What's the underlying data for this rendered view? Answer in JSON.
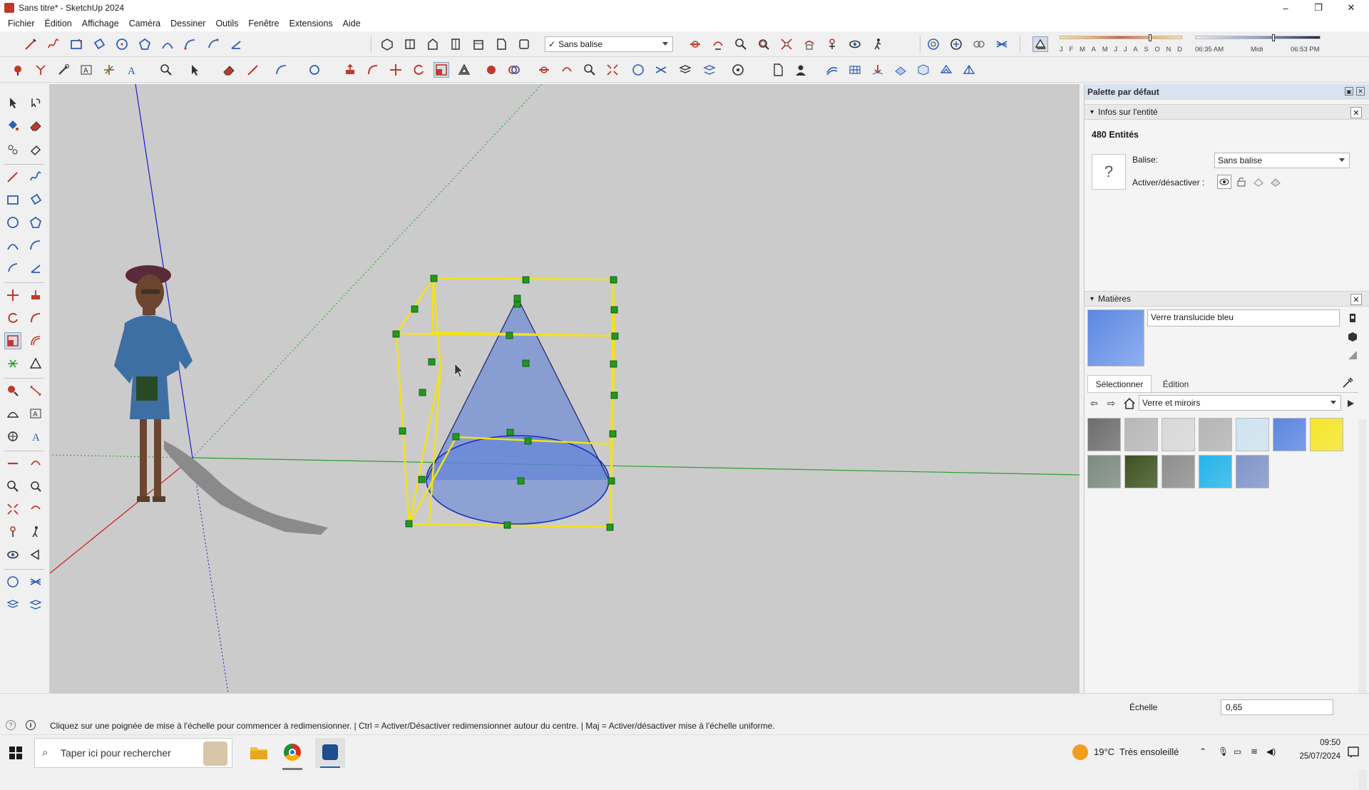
{
  "window": {
    "title": "Sans titre* - SketchUp 2024",
    "minimize": "–",
    "restore": "❐",
    "close": "✕"
  },
  "menu": [
    "Fichier",
    "Édition",
    "Affichage",
    "Caméra",
    "Dessiner",
    "Outils",
    "Fenêtre",
    "Extensions",
    "Aide"
  ],
  "toolbar": {
    "tag_selector": {
      "check": "✓",
      "value": "Sans balise"
    },
    "shadow": {
      "months": [
        "J",
        "F",
        "M",
        "A",
        "M",
        "J",
        "J",
        "A",
        "S",
        "O",
        "N",
        "D"
      ],
      "time_start": "06:35 AM",
      "time_mid": "Midi",
      "time_end": "06:53 PM",
      "month_level": 0.74,
      "time_level": 0.62
    }
  },
  "tray": {
    "title": "Palette par défaut",
    "entity_info": {
      "header": "Infos sur l'entité",
      "count": "480 Entités",
      "icon": "?",
      "tag_label": "Balise:",
      "tag_value": "Sans balise",
      "toggle_label": "Activer/désactiver :"
    },
    "materials": {
      "header": "Matières",
      "name": "Verre translucide bleu",
      "tab_select": "Sélectionner",
      "tab_edit": "Édition",
      "library": "Verre et miroirs",
      "current_color": "#5b86e0",
      "swatches": [
        {
          "name": "swatch-dark-glass-blocks",
          "color": "#6e6e6e"
        },
        {
          "name": "swatch-grey-gradient",
          "color": "#b8b8b8"
        },
        {
          "name": "swatch-light-grey",
          "color": "#d8d8d8"
        },
        {
          "name": "swatch-frosted-glass",
          "color": "#b5b5b5"
        },
        {
          "name": "swatch-light-blue-pattern",
          "color": "#cfe3f0"
        },
        {
          "name": "swatch-blue-glass",
          "color": "#5b86e0"
        },
        {
          "name": "swatch-yellow-glass",
          "color": "#f5e62a"
        },
        {
          "name": "swatch-green-grey-glass",
          "color": "#7c8a80"
        },
        {
          "name": "swatch-dark-green-glass",
          "color": "#3d5220"
        },
        {
          "name": "swatch-grey-mirror",
          "color": "#8e8e8e"
        },
        {
          "name": "swatch-cyan-glass",
          "color": "#25b4e8"
        },
        {
          "name": "swatch-blue-cloud-glass",
          "color": "#7f94c8"
        }
      ]
    },
    "scale": {
      "label": "Échelle",
      "value": "0,65"
    }
  },
  "status": {
    "hint": "Cliquez sur une poignée de mise à l'échelle pour commencer à redimensionner. | Ctrl = Activer/Désactiver redimensionner autour du centre. | Maj = Activer/désactiver mise à l'échelle uniforme."
  },
  "taskbar": {
    "search": "Taper ici pour rechercher",
    "weather": "19°C  Très ensoleillé",
    "time": "09:50",
    "date": "25/07/2024"
  },
  "colors": {
    "selection": "#f2e21a",
    "cone": "#5b80d8",
    "axis_red": "#d11a1a",
    "axis_green": "#2aa02a",
    "axis_blue": "#1a1ad1",
    "grip": "#1f9a1f"
  }
}
